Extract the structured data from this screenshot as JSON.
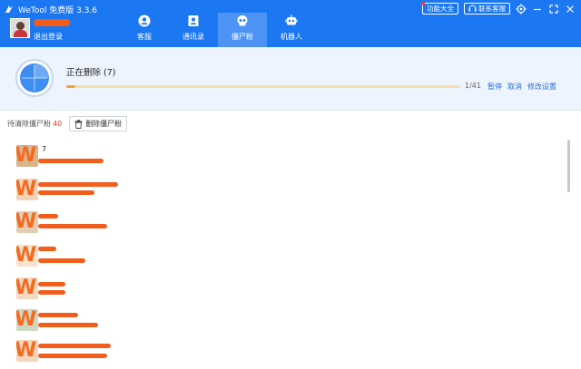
{
  "app": {
    "title": "WeTool 免费版 3.3.6",
    "logout_label": "退出登录"
  },
  "top_right": {
    "features_label": "功能大全",
    "support_label": "联系客服",
    "icons": [
      "settings-icon",
      "minimize-icon",
      "maximize-icon",
      "close-icon"
    ]
  },
  "nav": {
    "items": [
      {
        "label": "客服",
        "icon": "service-icon"
      },
      {
        "label": "通讯录",
        "icon": "contacts-icon"
      },
      {
        "label": "僵尸粉",
        "icon": "zombie-icon",
        "active": true
      },
      {
        "label": "机器人",
        "icon": "robot-icon"
      }
    ]
  },
  "progress": {
    "title": "正在删除 (7)",
    "count": "1/41",
    "fraction": 0.024,
    "actions": [
      "暂停",
      "取消",
      "修改设置"
    ]
  },
  "toolbar": {
    "pending_label": "待清除僵尸粉",
    "pending_count": "40",
    "delete_button": "删除僵尸粉"
  },
  "list": {
    "items": [
      {
        "name": "7"
      },
      {
        "name": ""
      },
      {
        "name": ""
      },
      {
        "name": ""
      },
      {
        "name": ""
      },
      {
        "name": ""
      },
      {
        "name": ""
      }
    ]
  },
  "colors": {
    "header": "#1b77f2",
    "active_tab": "#4d93f5",
    "progress_fill": "#f3a437",
    "accent_text": "#2b6fd6",
    "count_red": "#e03b2f"
  }
}
